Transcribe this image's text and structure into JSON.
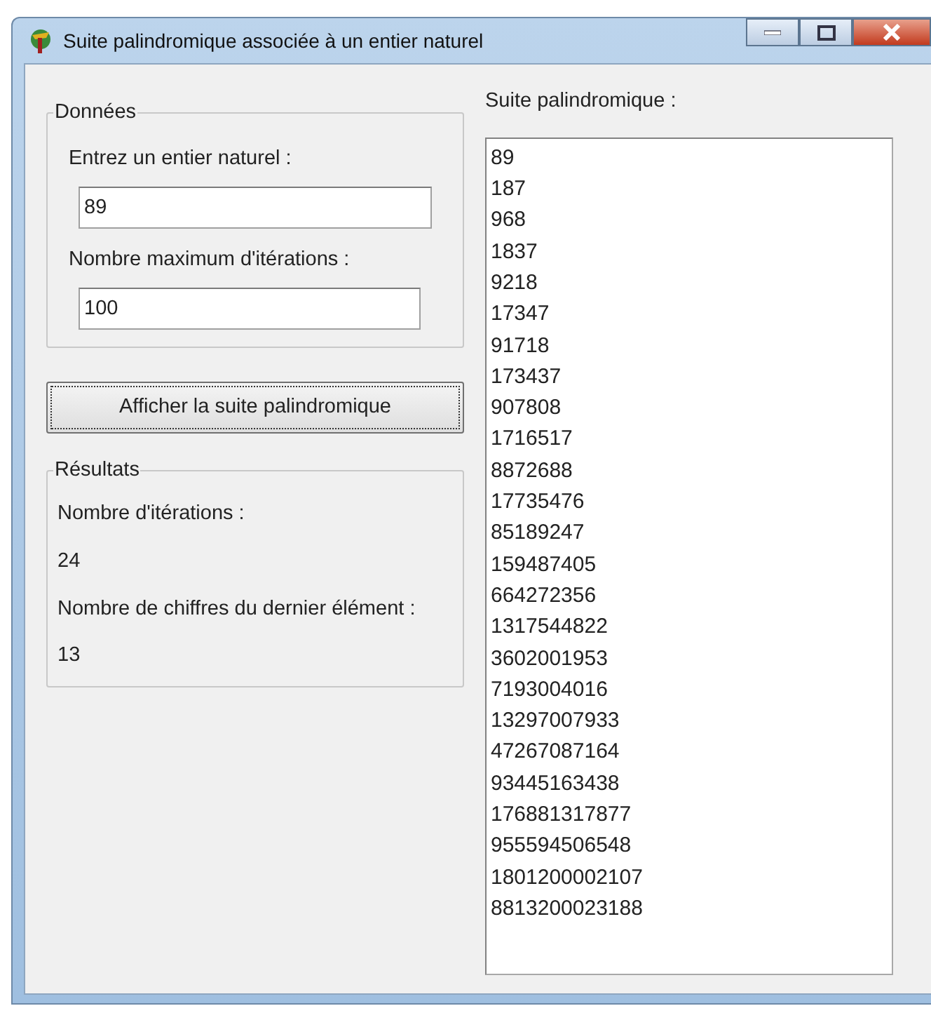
{
  "window": {
    "title": "Suite palindromique associée à un entier naturel"
  },
  "donnees": {
    "title": "Données",
    "fields": [
      {
        "label": "Entrez un entier naturel :",
        "value": "89"
      },
      {
        "label": "Nombre maximum d'itérations :",
        "value": "100"
      }
    ]
  },
  "button": {
    "label": "Afficher la suite palindromique",
    "focused": true
  },
  "resultats": {
    "title": "Résultats",
    "items": [
      {
        "label": "Nombre d'itérations :",
        "value": "24"
      },
      {
        "label": "Nombre de chiffres du dernier élément :",
        "value": "13"
      }
    ]
  },
  "suite": {
    "label": "Suite palindromique :",
    "items": [
      "89",
      "187",
      "968",
      "1837",
      "9218",
      "17347",
      "91718",
      "173437",
      "907808",
      "1716517",
      "8872688",
      "17735476",
      "85189247",
      "159487405",
      "664272356",
      "1317544822",
      "3602001953",
      "7193004016",
      "13297007933",
      "47267087164",
      "93445163438",
      "176881317877",
      "955594506548",
      "1801200002107",
      "8813200023188"
    ]
  }
}
